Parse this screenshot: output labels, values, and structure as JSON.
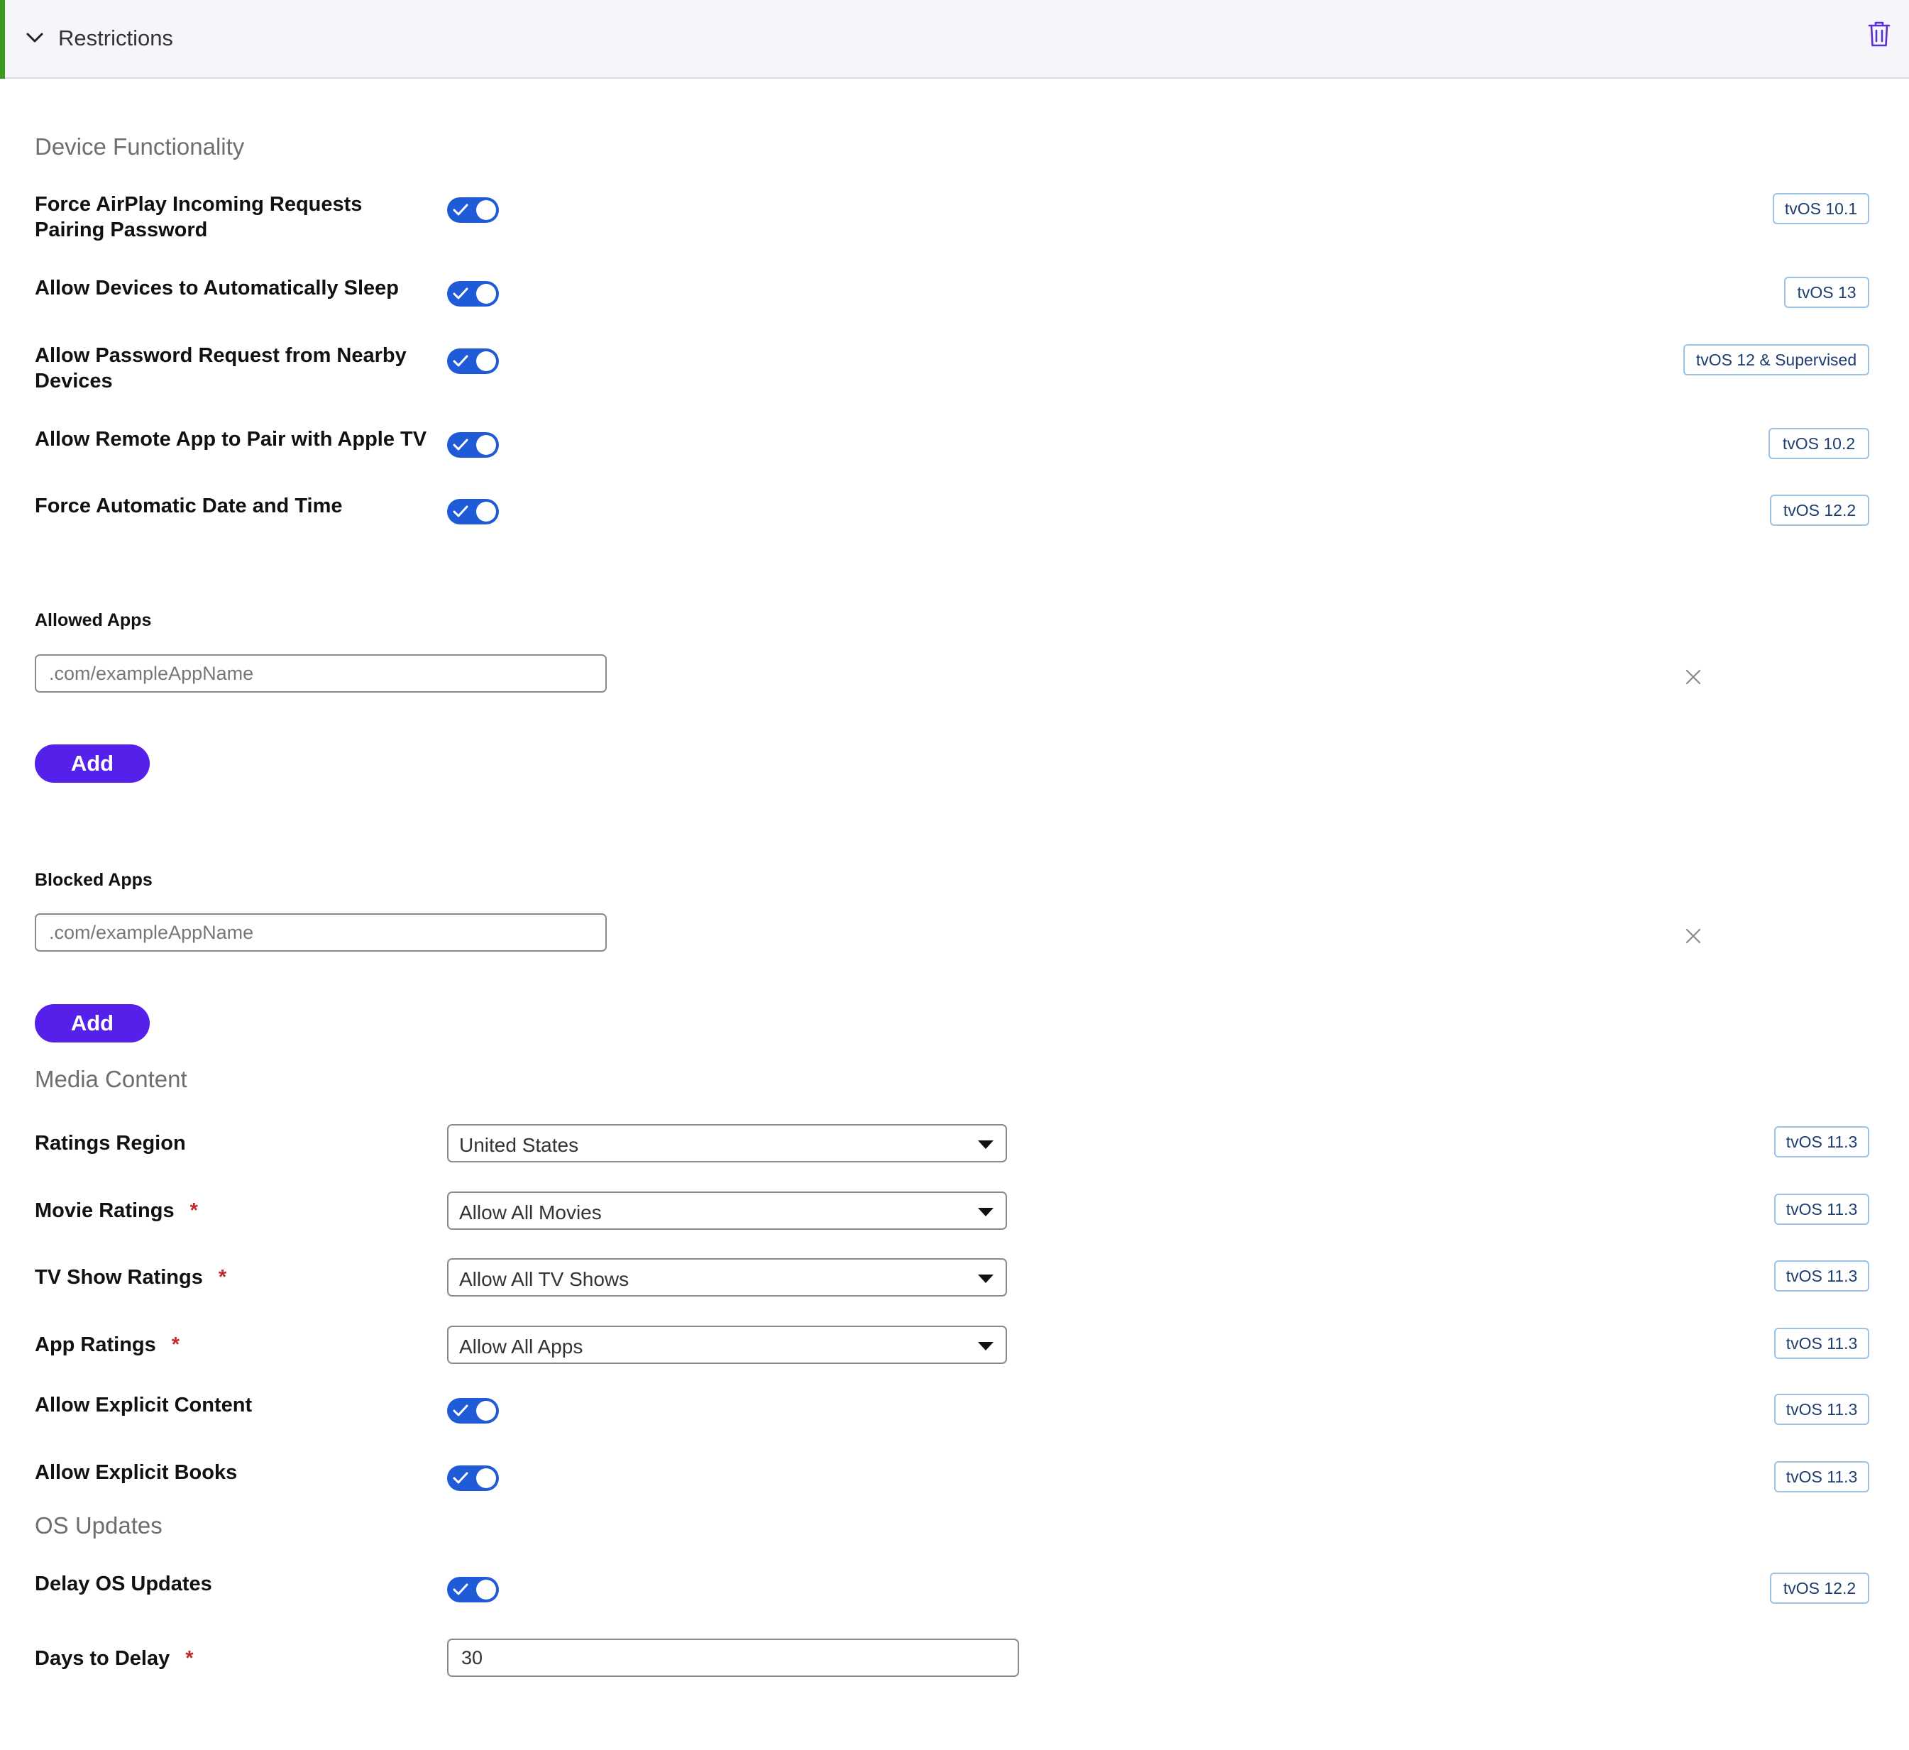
{
  "header": {
    "title": "Restrictions"
  },
  "device_functionality": {
    "title": "Device Functionality",
    "items": [
      {
        "label": "Force AirPlay Incoming Requests Pairing Password",
        "enabled": true,
        "badge": "tvOS 10.1"
      },
      {
        "label": "Allow Devices to Automatically Sleep",
        "enabled": true,
        "badge": "tvOS 13"
      },
      {
        "label": "Allow Password Request from Nearby Devices",
        "enabled": true,
        "badge": "tvOS 12 & Supervised"
      },
      {
        "label": "Allow Remote App to Pair with Apple TV",
        "enabled": true,
        "badge": "tvOS 10.2"
      },
      {
        "label": "Force Automatic Date and Time",
        "enabled": true,
        "badge": "tvOS 12.2"
      }
    ]
  },
  "allowed_apps": {
    "label": "Allowed Apps",
    "value": "",
    "placeholder": ".com/exampleAppName",
    "add_label": "Add"
  },
  "blocked_apps": {
    "label": "Blocked Apps",
    "value": "",
    "placeholder": ".com/exampleAppName",
    "add_label": "Add"
  },
  "media_content": {
    "title": "Media Content",
    "ratings_region": {
      "label": "Ratings Region",
      "value": "United States",
      "badge": "tvOS 11.3"
    },
    "movie_ratings": {
      "label": "Movie Ratings",
      "required": "*",
      "value": "Allow All Movies",
      "badge": "tvOS 11.3"
    },
    "tv_show_ratings": {
      "label": "TV Show Ratings",
      "required": "*",
      "value": "Allow All TV Shows",
      "badge": "tvOS 11.3"
    },
    "app_ratings": {
      "label": "App Ratings",
      "required": "*",
      "value": "Allow All Apps",
      "badge": "tvOS 11.3"
    },
    "explicit_content": {
      "label": "Allow Explicit Content",
      "enabled": true,
      "badge": "tvOS 11.3"
    },
    "explicit_books": {
      "label": "Allow Explicit Books",
      "enabled": true,
      "badge": "tvOS 11.3"
    }
  },
  "os_updates": {
    "title": "OS Updates",
    "delay_updates": {
      "label": "Delay OS Updates",
      "enabled": true,
      "badge": "tvOS 12.2"
    },
    "days_to_delay": {
      "label": "Days to Delay",
      "required": "*",
      "value": "30"
    }
  },
  "colors": {
    "accent_green": "#3c9a1e",
    "toggle_blue": "#1f5ad7",
    "button_purple": "#5521ea",
    "required_red": "#c0282d"
  }
}
